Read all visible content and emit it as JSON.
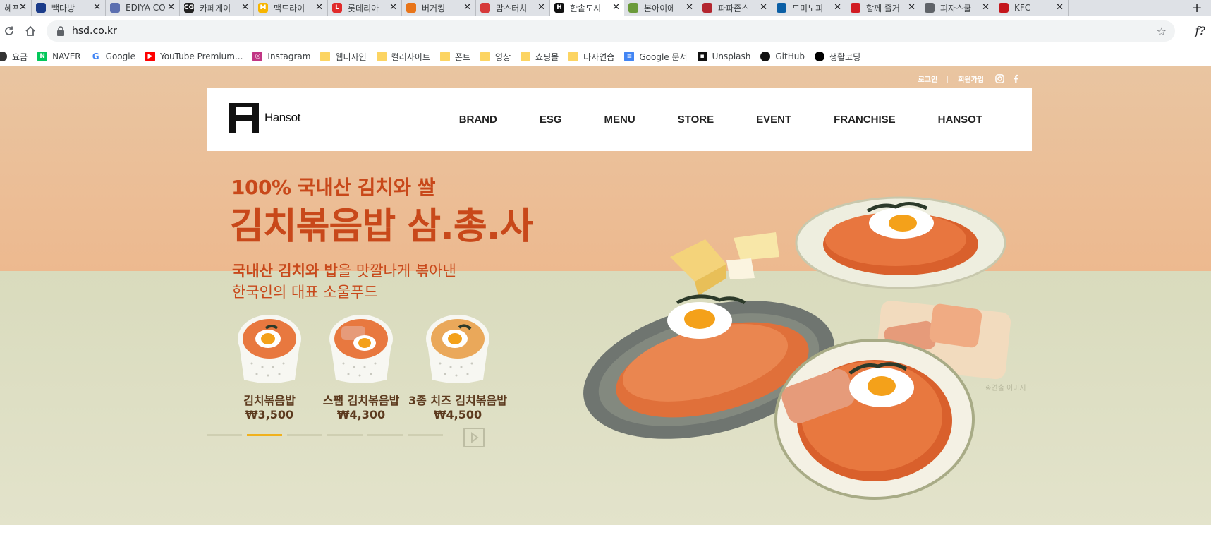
{
  "browser": {
    "tabs": [
      {
        "label": "혜프",
        "color": "#8a8a8a",
        "glyph": "",
        "active": false
      },
      {
        "label": "빽다방",
        "color": "#1b3c8a",
        "glyph": "",
        "active": false
      },
      {
        "label": "EDIYA CO",
        "color": "#5b6fb0",
        "glyph": "",
        "active": false
      },
      {
        "label": "카페게이",
        "color": "#222222",
        "glyph": "CG",
        "active": false
      },
      {
        "label": "맥드라이",
        "color": "#f7b500",
        "glyph": "M",
        "active": false
      },
      {
        "label": "롯데리아",
        "color": "#e02b2b",
        "glyph": "L",
        "active": false
      },
      {
        "label": "버거킹",
        "color": "#e8751a",
        "glyph": "",
        "active": false
      },
      {
        "label": "맘스터치",
        "color": "#d63a3a",
        "glyph": "",
        "active": false
      },
      {
        "label": "한솥도시",
        "color": "#111111",
        "glyph": "H",
        "active": true
      },
      {
        "label": "본아이에",
        "color": "#6a9a3a",
        "glyph": "",
        "active": false
      },
      {
        "label": "파파존스",
        "color": "#b3262f",
        "glyph": "",
        "active": false
      },
      {
        "label": "도미노피",
        "color": "#0b5fa5",
        "glyph": "",
        "active": false
      },
      {
        "label": "함께 즐거",
        "color": "#d11b22",
        "glyph": "",
        "active": false
      },
      {
        "label": "피자스쿨",
        "color": "#5f6368",
        "glyph": "",
        "active": false
      },
      {
        "label": "KFC",
        "color": "#c4161c",
        "glyph": "",
        "active": false
      }
    ],
    "url": "hsd.co.kr",
    "extension_label": "f?",
    "bookmarks": [
      {
        "label": "요금",
        "kind": "dot",
        "color": "#333333"
      },
      {
        "label": "NAVER",
        "kind": "square",
        "color": "#03c75a",
        "glyph": "N"
      },
      {
        "label": "Google",
        "kind": "g",
        "color": "#4285f4",
        "glyph": "G"
      },
      {
        "label": "YouTube Premium...",
        "kind": "square",
        "color": "#ff0000",
        "glyph": "▶"
      },
      {
        "label": "Instagram",
        "kind": "square",
        "color": "#c13584",
        "glyph": "◎"
      },
      {
        "label": "웹디자인",
        "kind": "folder",
        "color": "#fcd462"
      },
      {
        "label": "컬러사이트",
        "kind": "folder",
        "color": "#fcd462"
      },
      {
        "label": "폰트",
        "kind": "folder",
        "color": "#fcd462"
      },
      {
        "label": "영상",
        "kind": "folder",
        "color": "#fcd462"
      },
      {
        "label": "쇼핑몰",
        "kind": "folder",
        "color": "#fcd462"
      },
      {
        "label": "타자연습",
        "kind": "folder",
        "color": "#fcd462"
      },
      {
        "label": "Google 문서",
        "kind": "square",
        "color": "#4285f4",
        "glyph": "≡"
      },
      {
        "label": "Unsplash",
        "kind": "square",
        "color": "#111111",
        "glyph": "▪"
      },
      {
        "label": "GitHub",
        "kind": "dot",
        "color": "#111111"
      },
      {
        "label": "생활코딩",
        "kind": "dot",
        "color": "#000000"
      }
    ]
  },
  "site": {
    "util": {
      "login": "로그인",
      "signup": "회원가입"
    },
    "logo_text": "Hansot",
    "nav": [
      "BRAND",
      "ESG",
      "MENU",
      "STORE",
      "EVENT",
      "FRANCHISE",
      "HANSOT"
    ],
    "hero": {
      "headline_1": "100% 국내산 김치와 쌀",
      "headline_2": "김치볶음밥 삼.총.사",
      "sub_1_strong": "국내산 김치와 밥",
      "sub_1_rest": "을 맛깔나게 볶아낸",
      "sub_2": "한국인의 대표 소울푸드",
      "disclaimer": "※연출 이미지"
    },
    "products": [
      {
        "name": "김치볶음밥",
        "price": "₩3,500"
      },
      {
        "name": "스팸 김치볶음밥",
        "price": "₩4,300"
      },
      {
        "name": "3종 치즈 김치볶음밥",
        "price": "₩4,500"
      }
    ],
    "slider": {
      "count": 6,
      "active_index": 1
    },
    "colors": {
      "accent": "#c8481a",
      "pager_active": "#f0b11d",
      "brown": "#5c3a1e"
    }
  }
}
